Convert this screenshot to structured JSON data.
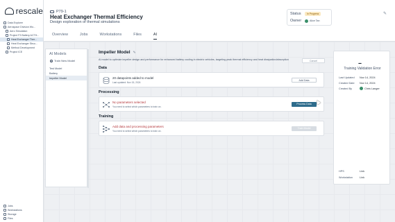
{
  "app": {
    "logo_text": "rescale"
  },
  "sidebar": {
    "items": [
      {
        "label": "Data Explorer"
      },
      {
        "label": "Aerospace Division Wo..."
      },
      {
        "label": "Aero Simulation"
      },
      {
        "label": "Project F3 Battery ACTH..."
      },
      {
        "label": "Heat Exchanger Ther..."
      },
      {
        "label": "Heat Exchanger Struc..."
      },
      {
        "label": "Method Development"
      },
      {
        "label": "Project ICE"
      }
    ],
    "bottom_items": [
      {
        "label": "Jobs"
      },
      {
        "label": "Workstations"
      },
      {
        "label": "Storage"
      },
      {
        "label": "Files"
      }
    ]
  },
  "header": {
    "project_id": "P79-1",
    "title": "Heat Exchanger Thermal Efficiency",
    "subtitle": "Design exploration of thermal simulations",
    "tabs": [
      {
        "label": "Overview"
      },
      {
        "label": "Jobs"
      },
      {
        "label": "Workstations"
      },
      {
        "label": "Files"
      },
      {
        "label": "AI"
      }
    ],
    "status_label": "Status",
    "status_value": "In Progress",
    "owner_label": "Owner",
    "owner_name": "Alice Tan"
  },
  "models_panel": {
    "title": "AI Models",
    "train_new": "Train New Model",
    "items": [
      {
        "label": "Test Model"
      },
      {
        "label": "Battery"
      },
      {
        "label": "Impeller Model"
      }
    ]
  },
  "main": {
    "model_title": "Impeller Model",
    "cancel_label": "Cancel",
    "description": "AI model to optimize impeller design and performance for enhanced battery cooling in electric vehicles, targeting peak thermal efficiency and heat dissipation/absorption",
    "data": {
      "heading": "Data",
      "title": "20 datapoints added to model",
      "sub": "Last updated: Nov 15, 2024",
      "button": "Add Data"
    },
    "processing": {
      "heading": "Processing",
      "title": "No parameters selected",
      "sub": "You need to select which parameters to train on.",
      "button": "Process Data"
    },
    "training": {
      "heading": "Training",
      "title": "Add data and processing parameters",
      "sub": "You need to select which parameters to train on.",
      "button": "Train Model"
    }
  },
  "right_panel": {
    "value": "--",
    "caption": "Training Validation Error",
    "rows": [
      {
        "label": "Last Updated",
        "value": "Nov 14, 2024"
      },
      {
        "label": "Created Date",
        "value": "Nov 14, 2024"
      },
      {
        "label": "Created By",
        "value": "Chris Langer"
      }
    ],
    "bottom_rows": [
      {
        "label": "HPS",
        "value": "Link"
      },
      {
        "label": "Workstation",
        "value": "Link"
      }
    ]
  },
  "colors": {
    "primary": "#2e6c8c",
    "warning_text": "#b3353a",
    "status_bg": "#fbe9c2"
  }
}
